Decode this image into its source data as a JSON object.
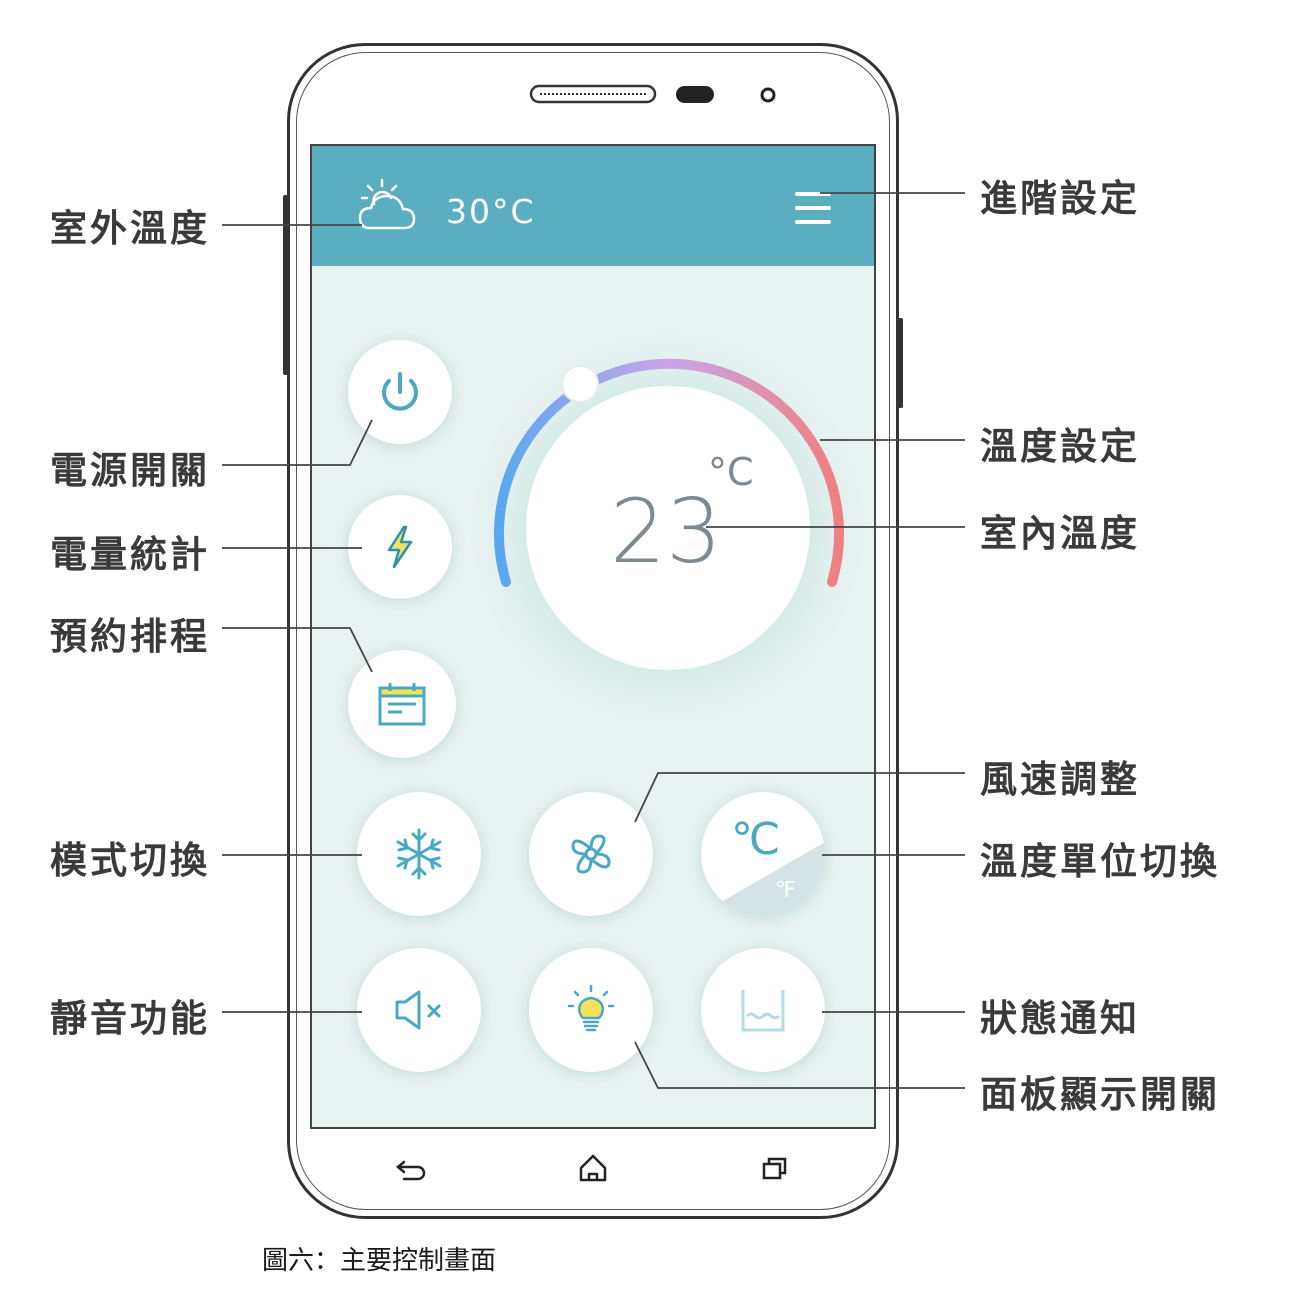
{
  "labels": {
    "outdoor_temp": "室外溫度",
    "power_switch": "電源開關",
    "power_stats": "電量統計",
    "schedule": "預約排程",
    "mode_switch": "模式切換",
    "mute": "靜音功能",
    "advanced_settings": "進階設定",
    "temp_setting": "溫度設定",
    "indoor_temp": "室內溫度",
    "fan_speed": "風速調整",
    "unit_switch": "溫度單位切換",
    "status_notify": "狀態通知",
    "panel_display": "面板顯示開關"
  },
  "screen": {
    "outdoor_temp_value": "30°C",
    "indoor_temp_value": "23",
    "indoor_temp_unit": "°C",
    "unit_c": "℃",
    "unit_f": "℉"
  },
  "caption": "圖六：主要控制畫面",
  "colors": {
    "topbar": "#5aaec0",
    "icon": "#4aa8c0",
    "arc_start": "#5aa8f0",
    "arc_mid": "#c9a6e8",
    "arc_end": "#ef8080"
  },
  "icons": [
    "cloud-sun-icon",
    "menu-icon",
    "power-icon",
    "lightning-icon",
    "calendar-icon",
    "snowflake-icon",
    "fan-icon",
    "celsius-icon",
    "mute-speaker-icon",
    "light-bulb-icon",
    "water-tank-icon",
    "back-icon",
    "home-icon",
    "recent-apps-icon"
  ]
}
